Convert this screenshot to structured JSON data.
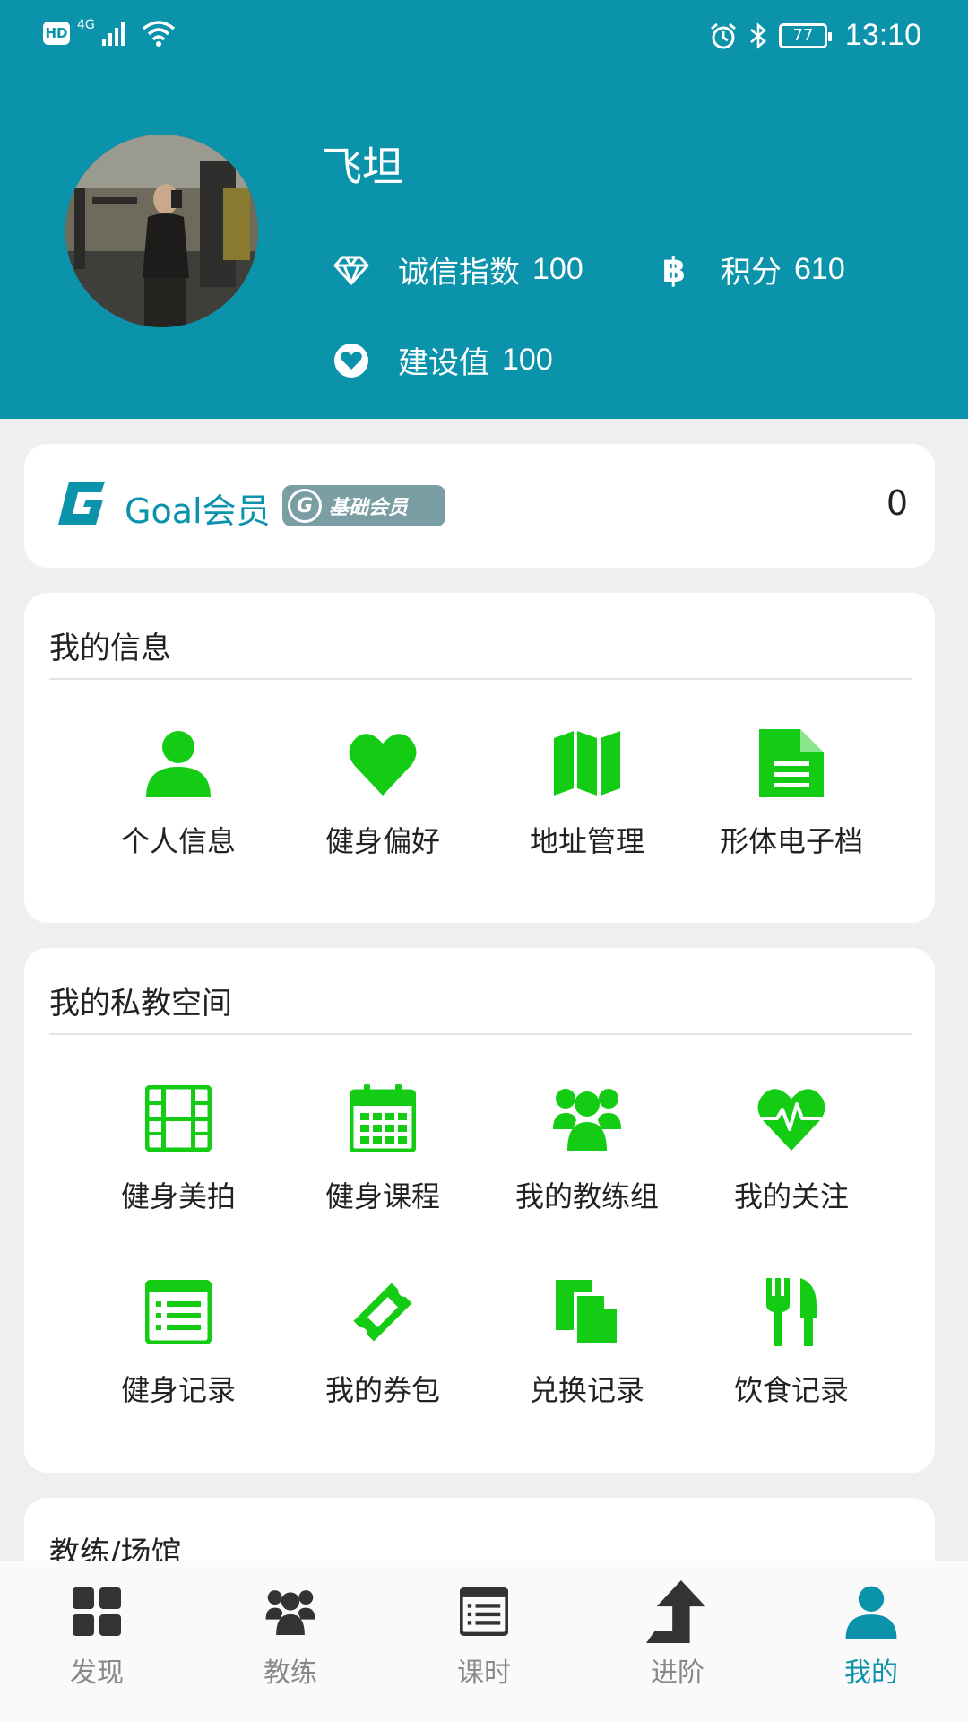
{
  "status_bar": {
    "hd": "HD",
    "network": "4G",
    "battery": "77",
    "time": "13:10"
  },
  "profile": {
    "name": "飞坦",
    "integrity_label": "诚信指数",
    "integrity_value": "100",
    "points_label": "积分",
    "points_value": "610",
    "build_label": "建设值",
    "build_value": "100"
  },
  "membership": {
    "title": "Goal会员",
    "badge": "基础会员",
    "value": "0"
  },
  "my_info": {
    "title": "我的信息",
    "items": [
      {
        "label": "个人信息",
        "icon": "person-icon"
      },
      {
        "label": "健身偏好",
        "icon": "heart-icon"
      },
      {
        "label": "地址管理",
        "icon": "map-icon"
      },
      {
        "label": "形体电子档",
        "icon": "document-icon"
      }
    ]
  },
  "private_space": {
    "title": "我的私教空间",
    "items": [
      {
        "label": "健身美拍",
        "icon": "film-icon"
      },
      {
        "label": "健身课程",
        "icon": "calendar-icon"
      },
      {
        "label": "我的教练组",
        "icon": "group-icon"
      },
      {
        "label": "我的关注",
        "icon": "heartbeat-icon"
      },
      {
        "label": "健身记录",
        "icon": "list-icon"
      },
      {
        "label": "我的券包",
        "icon": "ticket-icon"
      },
      {
        "label": "兑换记录",
        "icon": "copy-icon"
      },
      {
        "label": "饮食记录",
        "icon": "utensils-icon"
      }
    ]
  },
  "coach_venue": {
    "title": "教练/场馆"
  },
  "bottom_nav": {
    "items": [
      {
        "label": "发现",
        "icon": "grid-icon"
      },
      {
        "label": "教练",
        "icon": "users-icon"
      },
      {
        "label": "课时",
        "icon": "list-alt-icon"
      },
      {
        "label": "进阶",
        "icon": "level-up-icon"
      },
      {
        "label": "我的",
        "icon": "user-icon"
      }
    ],
    "active": "我的"
  },
  "colors": {
    "brand": "#0a93aa",
    "icon_green": "#14cc14",
    "nav_inactive": "#333333"
  }
}
